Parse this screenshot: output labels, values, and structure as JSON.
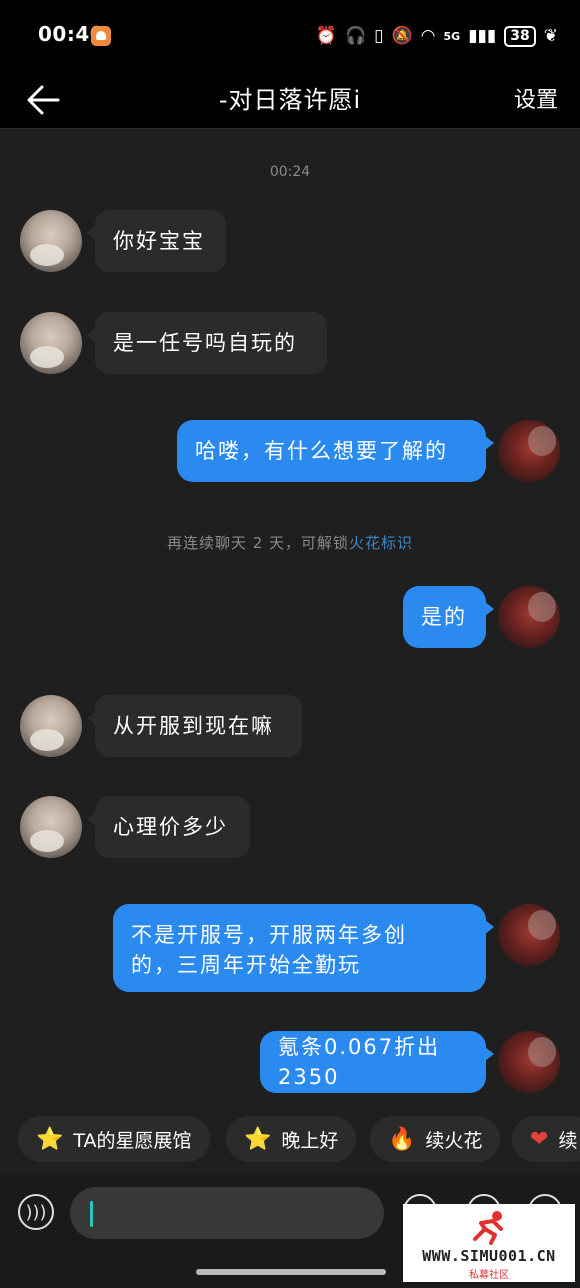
{
  "status": {
    "time": "00:40",
    "network": "5G",
    "battery": "38"
  },
  "header": {
    "title": "-对日落许愿i",
    "settings_label": "设置"
  },
  "chat": {
    "timestamp": "00:24",
    "messages": [
      {
        "from": "them",
        "text": "你好宝宝"
      },
      {
        "from": "them",
        "text": "是一任号吗自玩的"
      },
      {
        "from": "me",
        "text": "哈喽，有什么想要了解的"
      },
      {
        "from": "me",
        "text": "是的"
      },
      {
        "from": "them",
        "text": "从开服到现在嘛"
      },
      {
        "from": "them",
        "text": "心理价多少"
      },
      {
        "from": "me",
        "text": "不是开服号，开服两年多创\n的，三周年开始全勤玩"
      },
      {
        "from": "me",
        "text": "氪条0.067折出2350"
      }
    ],
    "system_note": {
      "prefix": "再连续聊天 2 天，可解锁",
      "link": "火花标识"
    }
  },
  "quick_replies": [
    {
      "icon": "star-face-icon",
      "label": "TA的星愿展馆"
    },
    {
      "icon": "star-face-icon",
      "label": "晚上好"
    },
    {
      "icon": "fire-icon",
      "label": "续火花"
    },
    {
      "icon": "heart-icon",
      "label": "续"
    }
  ],
  "input": {
    "placeholder": ""
  },
  "watermark": {
    "text": "WWW.SIMU001.CN",
    "subtext": "私募社区"
  },
  "colors": {
    "accent_bubble": "#2a8af0",
    "link": "#3c86c8",
    "chat_bg": "#1f1f1f"
  }
}
